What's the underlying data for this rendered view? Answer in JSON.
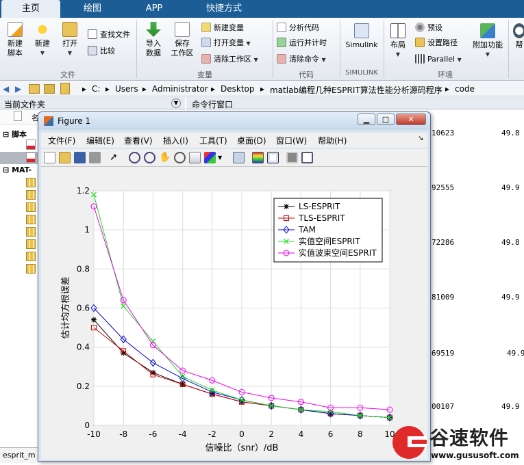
{
  "tabs": [
    "主页",
    "绘图",
    "APP",
    "快捷方式"
  ],
  "ribbon": {
    "new_script": "新建\n脚本",
    "new": "新建",
    "open": "打开",
    "find_files": "查找文件",
    "compare": "比较",
    "import_data": "导入\n数据",
    "save_workspace": "保存\n工作区",
    "new_variable": "新建变量",
    "open_variable": "打开变量",
    "clear_workspace": "清除工作区",
    "analyze_code": "分析代码",
    "run_and_time": "运行并计时",
    "clear_commands": "清除命令",
    "simulink": "Simulink",
    "layout": "布局",
    "preferences": "预设",
    "set_path": "设置路径",
    "parallel": "Parallel",
    "addons": "附加功能",
    "help": "帮",
    "groups": {
      "file": "文件",
      "variable": "变量",
      "code": "代码",
      "simulink": "SIMULINK",
      "environment": "环境"
    }
  },
  "address": {
    "crumbs": [
      "C:",
      "Users",
      "Administrator",
      "Desktop",
      "matlab编程几种ESPRIT算法性能分析源码程序",
      "code"
    ]
  },
  "left_panel": {
    "title": "当前文件夹",
    "col": "名",
    "section_scripts": "脚本",
    "section_mat": "MAT-",
    "footer_file": "esprit_m"
  },
  "command_window": {
    "title": "命令行窗口",
    "rows": [
      {
        "a": "10623",
        "b": "49.8"
      },
      {
        "a": "92555",
        "b": "49.9"
      },
      {
        "a": "72286",
        "b": "49.8"
      },
      {
        "a": "81009",
        "b": "49.9"
      },
      {
        "a": "69519",
        "b": "49.9"
      },
      {
        "a": "00107",
        "b": "49.9"
      }
    ]
  },
  "figure": {
    "title": "Figure 1",
    "menu": [
      "文件(F)",
      "编辑(E)",
      "查看(V)",
      "插入(I)",
      "工具(T)",
      "桌面(D)",
      "窗口(W)",
      "帮助(H)"
    ]
  },
  "watermark": {
    "brand": "谷速软件",
    "url": "www.gususoft.com"
  },
  "colors": {
    "ribbon_tab_bar": "#1b5d94",
    "ls": "#000000",
    "tls": "#cc0000",
    "tam": "#0000dd",
    "real": "#22dd22",
    "beam": "#ee00ee"
  },
  "chart_data": {
    "type": "line",
    "title": "",
    "xlabel": "信噪比（snr）/dB",
    "ylabel": "估计均方根误差",
    "x": [
      -10,
      -8,
      -6,
      -4,
      -2,
      0,
      2,
      4,
      6,
      8,
      10
    ],
    "xlim": [
      -10,
      10
    ],
    "ylim": [
      0,
      1.2
    ],
    "xticks": [
      "-10",
      "-8",
      "-6",
      "-4",
      "-2",
      "0",
      "2",
      "4",
      "6",
      "8",
      "10"
    ],
    "yticks": [
      "0",
      "0.2",
      "0.4",
      "0.6",
      "0.8",
      "1",
      "1.2"
    ],
    "grid": true,
    "legend_position": "top-right",
    "series": [
      {
        "name": "LS-ESPRIT",
        "marker": "star",
        "values": [
          0.54,
          0.37,
          0.27,
          0.21,
          0.16,
          0.12,
          0.1,
          0.08,
          0.06,
          0.05,
          0.04
        ]
      },
      {
        "name": "TLS-ESPRIT",
        "marker": "square",
        "values": [
          0.5,
          0.38,
          0.26,
          0.21,
          0.16,
          0.12,
          0.1,
          0.08,
          0.06,
          0.05,
          0.04
        ]
      },
      {
        "name": "TAM",
        "marker": "diamond",
        "values": [
          0.6,
          0.44,
          0.32,
          0.24,
          0.17,
          0.13,
          0.1,
          0.08,
          0.06,
          0.05,
          0.04
        ]
      },
      {
        "name": "实值空间ESPRIT",
        "marker": "x",
        "values": [
          1.18,
          0.61,
          0.43,
          0.25,
          0.18,
          0.13,
          0.1,
          0.08,
          0.07,
          0.05,
          0.04
        ]
      },
      {
        "name": "实值波束空间ESPRIT",
        "marker": "circle",
        "values": [
          1.12,
          0.64,
          0.41,
          0.28,
          0.23,
          0.17,
          0.14,
          0.12,
          0.09,
          0.09,
          0.08
        ]
      }
    ]
  }
}
